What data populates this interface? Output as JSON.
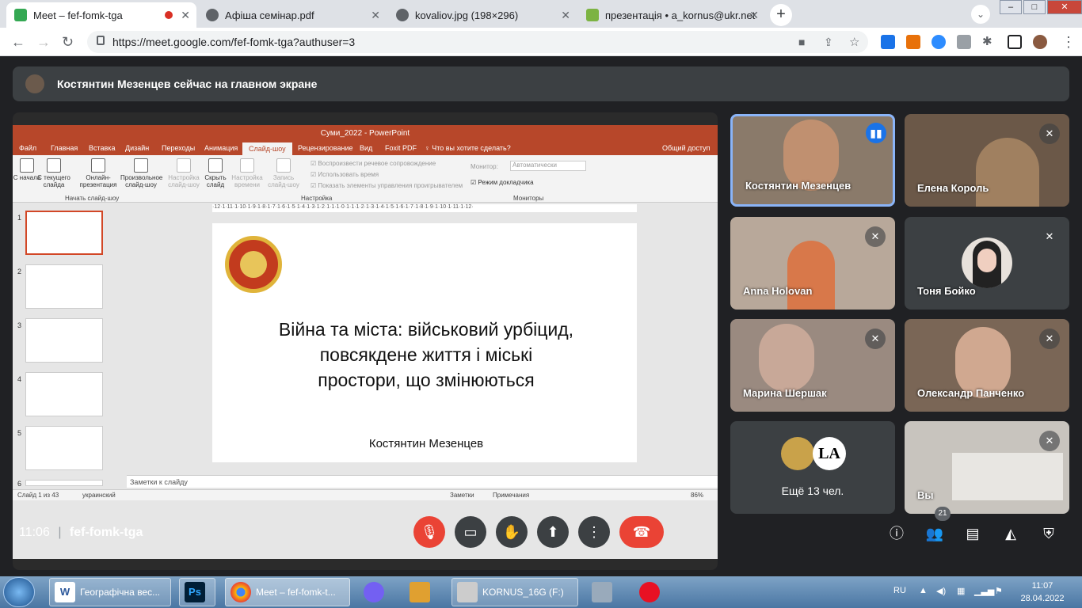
{
  "browser": {
    "tabs": [
      {
        "title": "Meet – fef-fomk-tga",
        "color": "#34a853"
      },
      {
        "title": "Афіша семінар.pdf",
        "color": "#5f6368"
      },
      {
        "title": "kovaliov.jpg (198×296)",
        "color": "#5f6368"
      },
      {
        "title": "презентація • a_kornus@ukr.net",
        "color": "#7cb342"
      }
    ],
    "new_tab": "+",
    "url": "https://meet.google.com/fef-fomk-tga?authuser=3",
    "win_min": "–",
    "win_max": "□",
    "win_close": "✕"
  },
  "banner": {
    "text": "Костянтин Мезенцев сейчас на главном экране"
  },
  "ppt": {
    "window_title": "Суми_2022 - PowerPoint",
    "tabs": [
      "Файл",
      "Главная",
      "Вставка",
      "Дизайн",
      "Переходы",
      "Анимация",
      "Слайд-шоу",
      "Рецензирование",
      "Вид",
      "Foxit PDF",
      "♀ Что вы хотите сделать?",
      "Общий доступ"
    ],
    "ribbon": {
      "btn_from_start": "С начала",
      "btn_from_current": "С текущего слайда",
      "btn_online": "Онлайн-презентация",
      "btn_custom": "Произвольное слайд-шоу",
      "btn_setup": "Настройка слайд-шоу",
      "btn_hide": "Скрыть слайд",
      "btn_timing": "Настройка времени",
      "btn_record": "Запись слайд-шоу",
      "chk_narration": "Воспроизвести речевое сопровождение",
      "chk_timings": "Использовать время",
      "chk_controls": "Показать элементы управления проигрывателем",
      "monitor_label": "Монитор:",
      "monitor_value": "Автоматически",
      "presenter_view": "Режим докладчика",
      "group_start": "Начать слайд-шоу",
      "group_setup": "Настройка",
      "group_monitors": "Мониторы"
    },
    "thumb_numbers": [
      "1",
      "2",
      "3",
      "4",
      "5",
      "6"
    ],
    "ruler": "·12·1·11·1·10·1·9·1·8·1·7·1·6·1·5·1·4·1·3·1·2·1·1·1·0·1·1·1·2·1·3·1·4·1·5·1·6·1·7·1·8·1·9·1·10·1·11·1·12·",
    "slide_title": "Війна та міста: військовий урбіцид,\nповсякдене життя і міські\nпростори, що змінюються",
    "slide_author": "Костянтин Мезенцев",
    "notes": "Заметки к слайду",
    "status_slide": "Слайд 1 из 43",
    "status_lang": "украинский",
    "status_notes": "Заметки",
    "status_comments": "Примечания",
    "zoom": "86%"
  },
  "participants": [
    {
      "name": "Костянтин Мезенцев",
      "bg": "#8a7a6a"
    },
    {
      "name": "Елена Король",
      "bg": "#6b5848"
    },
    {
      "name": "Anna Holovan",
      "bg": "#b8a89a"
    },
    {
      "name": "Тоня Бойко",
      "bg": "#3c4043"
    },
    {
      "name": "Марина Шершак",
      "bg": "#9a8a80"
    },
    {
      "name": "Олександр Панченко",
      "bg": "#7a6656"
    }
  ],
  "more": {
    "label": "Ещё 13 чел.",
    "avatar_text": "LA"
  },
  "self": {
    "name": "Вы"
  },
  "bottom": {
    "time": "11:06",
    "separator": "|",
    "meeting_code": "fef-fomk-tga",
    "participant_count": "21"
  },
  "taskbar": {
    "items": [
      "Географічна вес...",
      "Meet – fef-fomk-t...",
      "KORNUS_16G (F:)"
    ],
    "ps": "Ps",
    "word": "W",
    "lang": "RU",
    "clock_time": "11:07",
    "clock_date": "28.04.2022"
  }
}
